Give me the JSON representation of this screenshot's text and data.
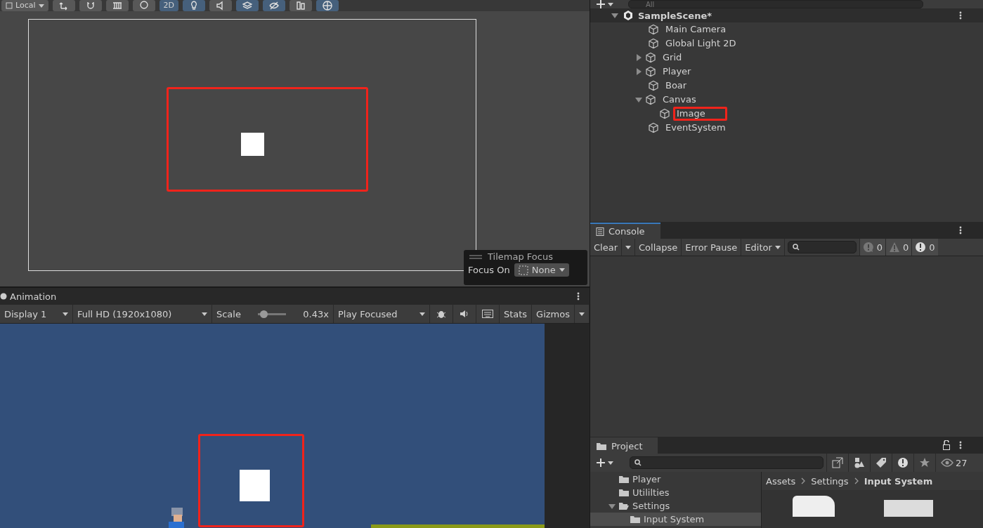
{
  "scene_toolbar": {
    "items": [
      {
        "kind": "dropdown",
        "label": "Local"
      },
      {
        "kind": "icon",
        "on": false
      },
      {
        "kind": "icon",
        "on": false
      },
      {
        "kind": "icon",
        "on": false
      },
      {
        "kind": "icon",
        "on": false
      },
      {
        "kind": "text",
        "label": "2D",
        "on": true
      },
      {
        "kind": "icon",
        "on": true
      },
      {
        "kind": "icon",
        "on": false
      },
      {
        "kind": "icon",
        "on": true
      },
      {
        "kind": "icon",
        "on": true
      },
      {
        "kind": "icon",
        "on": false
      },
      {
        "kind": "icon",
        "on": true
      }
    ]
  },
  "scene_view": {
    "tilemap_focus": {
      "title": "Tilemap Focus",
      "label": "Focus On",
      "value": "None"
    }
  },
  "game_panel": {
    "tab": "Animation",
    "display": "Display 1",
    "resolution": "Full HD (1920x1080)",
    "scale_label": "Scale",
    "scale": {
      "level": 0.08
    },
    "scale_value": "0.43x",
    "play_mode": "Play Focused",
    "stats": "Stats",
    "gizmos": "Gizmos"
  },
  "hierarchy": {
    "search": {
      "placeholder": "All"
    },
    "scene": "SampleScene*",
    "items": [
      {
        "label": "Main Camera",
        "highlighted": false
      },
      {
        "label": "Global Light 2D",
        "highlighted": false
      },
      {
        "label": "Grid",
        "expanded": false,
        "highlighted": false
      },
      {
        "label": "Player",
        "expanded": false,
        "highlighted": false
      },
      {
        "label": "Boar",
        "highlighted": false
      },
      {
        "label": "Canvas",
        "expanded": true,
        "highlighted": false,
        "children": [
          {
            "label": "Image",
            "highlighted": true
          }
        ]
      },
      {
        "label": "EventSystem",
        "highlighted": false
      }
    ]
  },
  "console": {
    "tab": "Console",
    "buttons": [
      "Clear",
      "Collapse",
      "Error Pause"
    ],
    "filter": "Editor",
    "counts": [
      {
        "kind": "info",
        "count": "0"
      },
      {
        "kind": "warning",
        "count": "0"
      },
      {
        "kind": "error",
        "count": "0"
      }
    ]
  },
  "project": {
    "tab": "Project",
    "count": "27",
    "tree": [
      {
        "label": "Player",
        "selected": false
      },
      {
        "label": "Utililties",
        "selected": false
      },
      {
        "label": "Settings",
        "expanded": true,
        "selected": false,
        "children": [
          {
            "label": "Input System",
            "selected": true
          }
        ]
      }
    ],
    "breadcrumb": [
      "Assets",
      "Settings",
      "Input System"
    ]
  }
}
